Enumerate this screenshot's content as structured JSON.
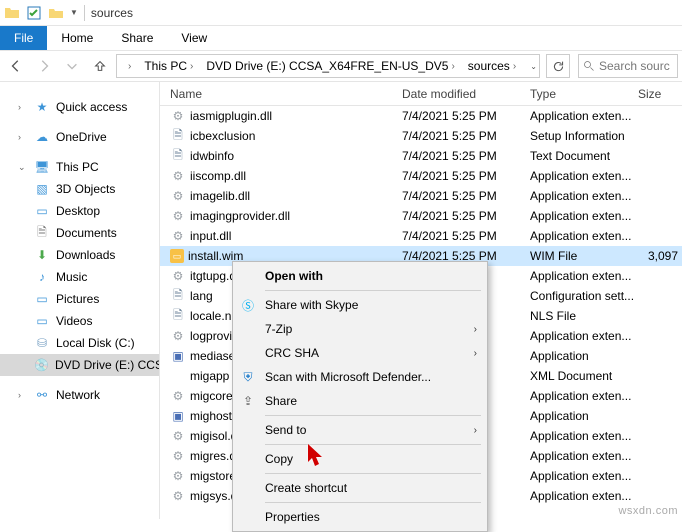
{
  "title": "sources",
  "ribbon": {
    "file": "File",
    "home": "Home",
    "share": "Share",
    "view": "View"
  },
  "breadcrumbs": [
    "This PC",
    "DVD Drive (E:) CCSA_X64FRE_EN-US_DV5",
    "sources"
  ],
  "search_placeholder": "Search sourc",
  "nav": {
    "quick": "Quick access",
    "onedrive": "OneDrive",
    "thispc": "This PC",
    "items": [
      "3D Objects",
      "Desktop",
      "Documents",
      "Downloads",
      "Music",
      "Pictures",
      "Videos",
      "Local Disk (C:)",
      "DVD Drive (E:) CCSA"
    ],
    "network": "Network"
  },
  "columns": {
    "name": "Name",
    "date": "Date modified",
    "type": "Type",
    "size": "Size"
  },
  "files": [
    {
      "icon": "dll",
      "name": "iasmigplugin.dll",
      "date": "7/4/2021 5:25 PM",
      "type": "Application exten...",
      "size": ""
    },
    {
      "icon": "txt",
      "name": "icbexclusion",
      "date": "7/4/2021 5:25 PM",
      "type": "Setup Information",
      "size": ""
    },
    {
      "icon": "txt",
      "name": "idwbinfo",
      "date": "7/4/2021 5:25 PM",
      "type": "Text Document",
      "size": ""
    },
    {
      "icon": "dll",
      "name": "iiscomp.dll",
      "date": "7/4/2021 5:25 PM",
      "type": "Application exten...",
      "size": ""
    },
    {
      "icon": "dll",
      "name": "imagelib.dll",
      "date": "7/4/2021 5:25 PM",
      "type": "Application exten...",
      "size": ""
    },
    {
      "icon": "dll",
      "name": "imagingprovider.dll",
      "date": "7/4/2021 5:25 PM",
      "type": "Application exten...",
      "size": ""
    },
    {
      "icon": "dll",
      "name": "input.dll",
      "date": "7/4/2021 5:25 PM",
      "type": "Application exten...",
      "size": ""
    },
    {
      "icon": "wim",
      "name": "install.wim",
      "date": "7/4/2021 5:25 PM",
      "type": "WIM File",
      "size": "3,097",
      "selected": true
    },
    {
      "icon": "dll",
      "name": "itgtupg.dll",
      "date": "",
      "type": "Application exten...",
      "size": ""
    },
    {
      "icon": "txt",
      "name": "lang",
      "date": "",
      "type": "Configuration sett...",
      "size": ""
    },
    {
      "icon": "txt",
      "name": "locale.nls",
      "date": "",
      "type": "NLS File",
      "size": ""
    },
    {
      "icon": "dll",
      "name": "logprovide",
      "date": "",
      "type": "Application exten...",
      "size": ""
    },
    {
      "icon": "exe",
      "name": "mediasetu",
      "date": "",
      "type": "Application",
      "size": ""
    },
    {
      "icon": "xml",
      "name": "migapp",
      "date": "",
      "type": "XML Document",
      "size": ""
    },
    {
      "icon": "dll",
      "name": "migcore.dl",
      "date": "",
      "type": "Application exten...",
      "size": ""
    },
    {
      "icon": "exe",
      "name": "mighost",
      "date": "",
      "type": "Application",
      "size": ""
    },
    {
      "icon": "dll",
      "name": "migisol.dll",
      "date": "",
      "type": "Application exten...",
      "size": ""
    },
    {
      "icon": "dll",
      "name": "migres.dll",
      "date": "",
      "type": "Application exten...",
      "size": ""
    },
    {
      "icon": "dll",
      "name": "migstore.d",
      "date": "",
      "type": "Application exten...",
      "size": ""
    },
    {
      "icon": "dll",
      "name": "migsys.dll",
      "date": "",
      "type": "Application exten...",
      "size": ""
    }
  ],
  "ctx": {
    "openwith": "Open with",
    "skype": "Share with Skype",
    "sevenzip": "7-Zip",
    "crcsha": "CRC SHA",
    "defender": "Scan with Microsoft Defender...",
    "share": "Share",
    "sendto": "Send to",
    "copy": "Copy",
    "shortcut": "Create shortcut",
    "properties": "Properties"
  },
  "watermark": "wsxdn.com"
}
